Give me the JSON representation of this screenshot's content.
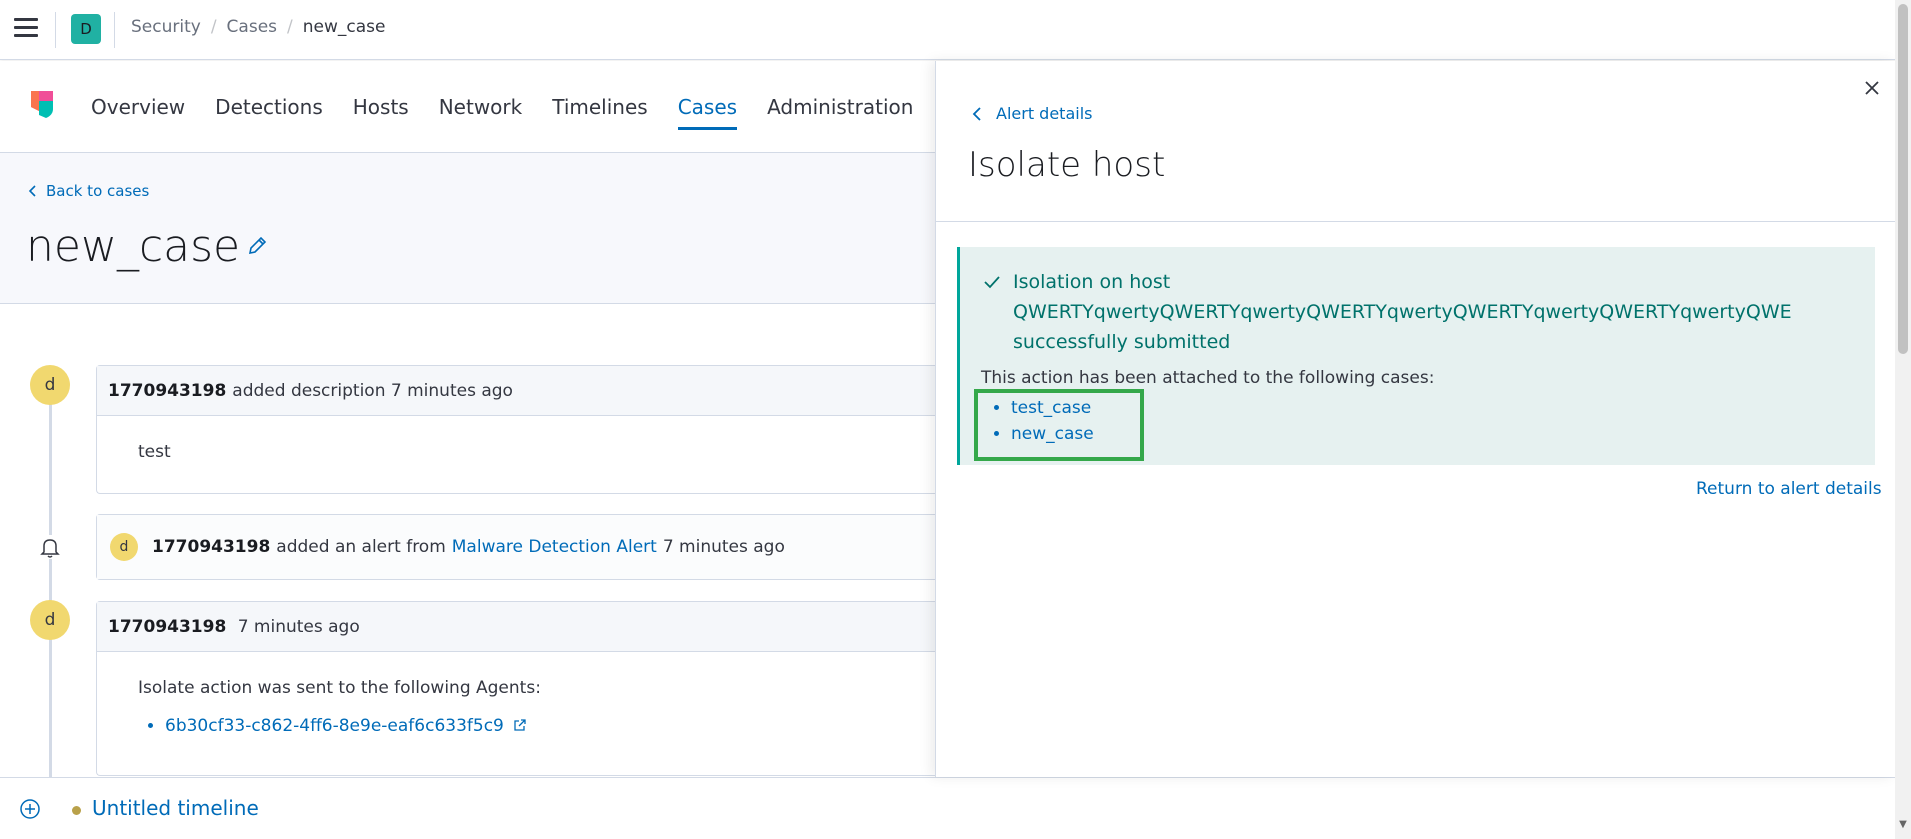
{
  "header": {
    "space_initial": "D",
    "breadcrumbs": [
      "Security",
      "Cases",
      "new_case"
    ]
  },
  "nav": {
    "tabs": [
      "Overview",
      "Detections",
      "Hosts",
      "Network",
      "Timelines",
      "Cases",
      "Administration"
    ],
    "active_tab": "Cases"
  },
  "case": {
    "back_label": "Back to cases",
    "title": "new_case"
  },
  "timeline": {
    "items": [
      {
        "avatar": "d",
        "user": "1770943198",
        "action": "added description",
        "time": "7 minutes ago",
        "body": "test"
      },
      {
        "avatar": "d",
        "user": "1770943198",
        "action": "added an alert from",
        "link": "Malware Detection Alert",
        "time": "7 minutes ago"
      },
      {
        "avatar": "d",
        "user": "1770943198",
        "time": "7 minutes ago",
        "body": "Isolate action was sent to the following Agents:",
        "agent": "6b30cf33-c862-4ff6-8e9e-eaf6c633f5c9"
      }
    ]
  },
  "bottom_bar": {
    "timeline_name": "Untitled timeline"
  },
  "flyout": {
    "back_label": "Alert details",
    "title": "Isolate host",
    "callout": {
      "line1": "Isolation on host",
      "line2": "QWERTYqwertyQWERTYqwertyQWERTYqwertyQWERTYqwertyQWERTYqwertyQWE",
      "line3": "successfully submitted",
      "attached_text": "This action has been attached to the following cases:",
      "cases": [
        "test_case",
        "new_case"
      ]
    },
    "return_label": "Return to alert details"
  },
  "colors": {
    "link": "#006bb8",
    "success_text": "#00726b",
    "success_bg": "#e6f1f0",
    "highlight_border": "#34a84a",
    "avatar": "#f1d86f",
    "space_avatar": "#20b1a3"
  }
}
